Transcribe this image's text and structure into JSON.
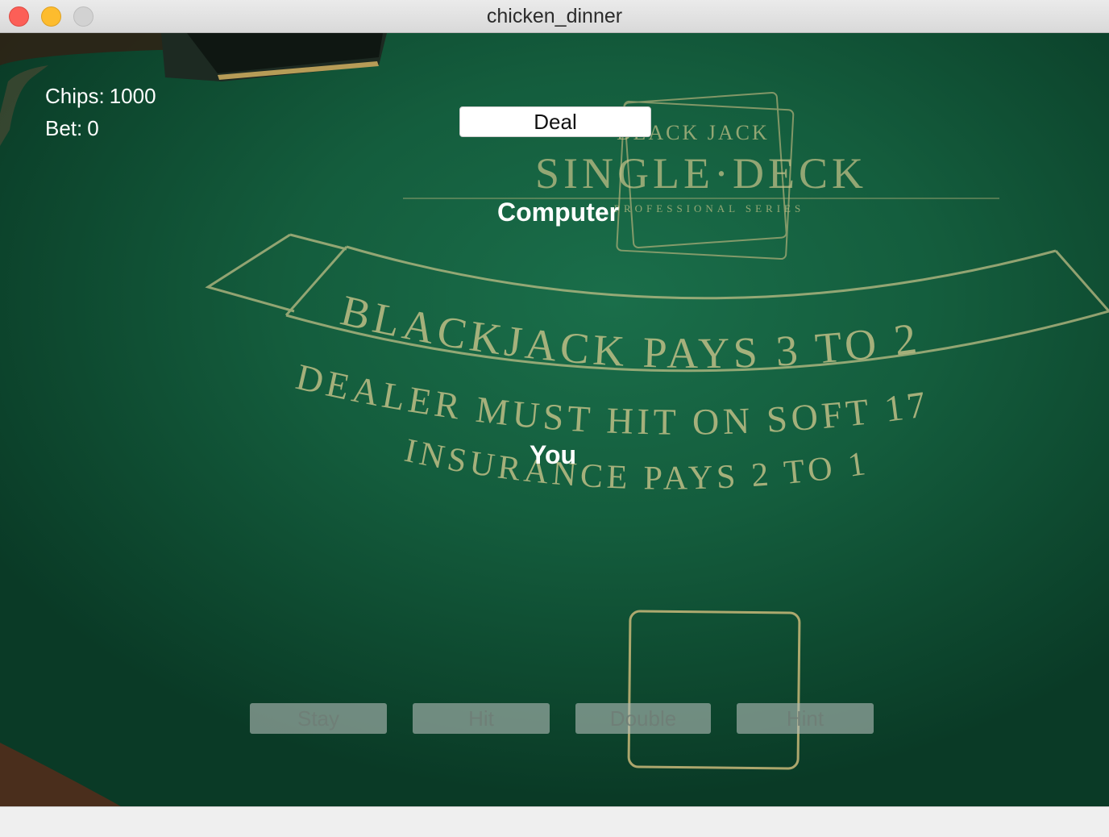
{
  "window": {
    "title": "chicken_dinner"
  },
  "table_print": {
    "logo_top": "BLACK JACK",
    "logo_main": "SINGLE·DECK",
    "logo_sub": "PROFESSIONAL SERIES",
    "banner": "BLACKJACK PAYS 3 TO 2",
    "rule_1": "DEALER MUST HIT ON SOFT 17",
    "rule_2": "INSURANCE PAYS 2 TO 1"
  },
  "stats": {
    "chips_label": "Chips:",
    "chips_value": "1000",
    "bet_label": "Bet:",
    "bet_value": "0"
  },
  "deal_button": "Deal",
  "seats": {
    "dealer": "Computer",
    "player": "You"
  },
  "actions": {
    "stay": "Stay",
    "hit": "Hit",
    "double": "Double",
    "hint": "Hint"
  },
  "colors": {
    "felt": "#145d3d",
    "gold_print": "#c9c48a",
    "close": "#fc5f57",
    "minimize": "#fdbc2e",
    "zoom": "#d2d2d2"
  }
}
